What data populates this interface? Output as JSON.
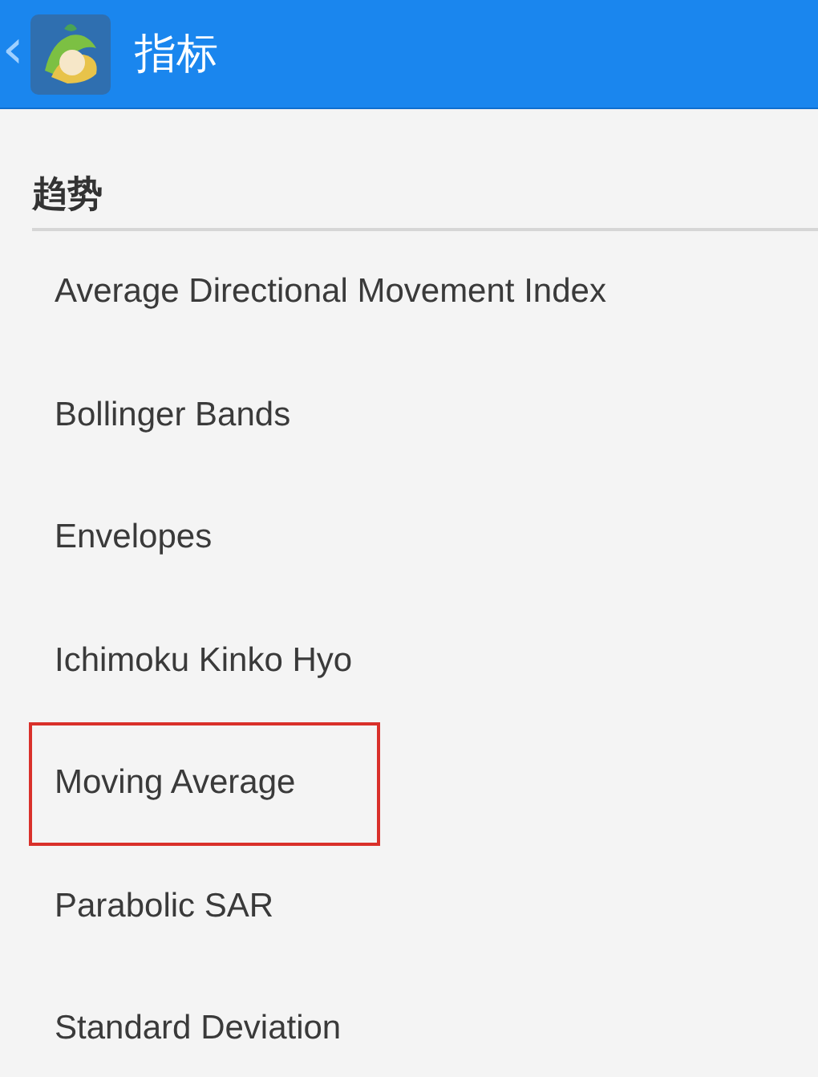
{
  "header": {
    "back": "‹",
    "title": "指标"
  },
  "section": {
    "title": "趋势"
  },
  "items": [
    {
      "label": "Average Directional Movement Index",
      "highlighted": false
    },
    {
      "label": "Bollinger Bands",
      "highlighted": false
    },
    {
      "label": "Envelopes",
      "highlighted": false
    },
    {
      "label": "Ichimoku Kinko Hyo",
      "highlighted": false
    },
    {
      "label": "Moving Average",
      "highlighted": true
    },
    {
      "label": "Parabolic SAR",
      "highlighted": false
    },
    {
      "label": "Standard Deviation",
      "highlighted": false
    }
  ]
}
